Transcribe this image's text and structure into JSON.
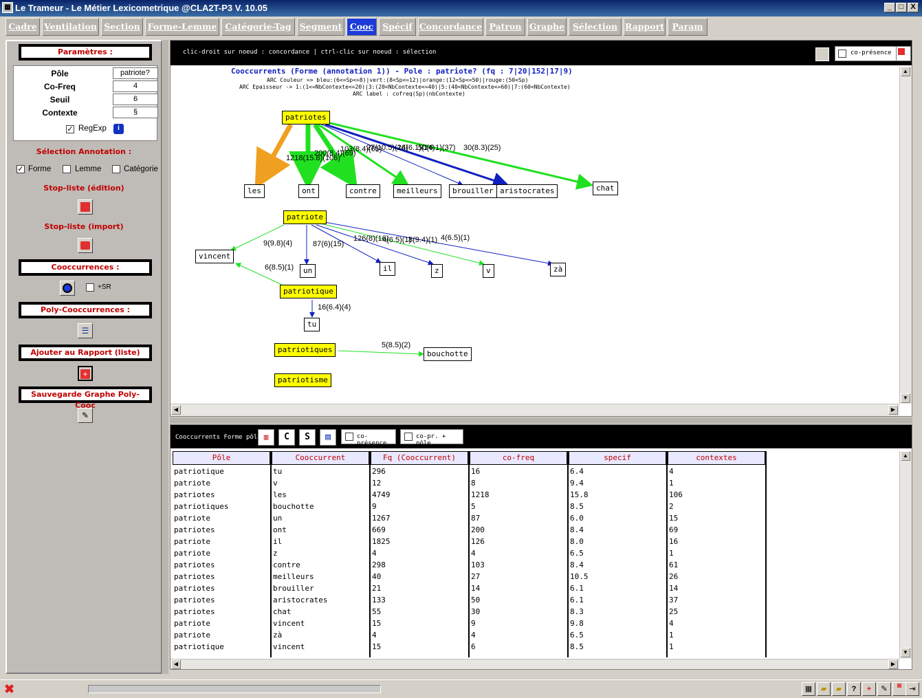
{
  "window": {
    "title": "Le Trameur - Le Métier Lexicometrique @CLA2T-P3 V. 10.05",
    "app_icon": "trameur-app-icon",
    "controls": [
      "_",
      "□",
      "X"
    ]
  },
  "tabs": [
    {
      "label": "Cadre",
      "active": false
    },
    {
      "label": "Ventilation",
      "active": false
    },
    {
      "label": "Section",
      "active": false
    },
    {
      "label": "Forme-Lemme",
      "active": false
    },
    {
      "label": "Catégorie-Tag",
      "active": false
    },
    {
      "label": "Segment",
      "active": false
    },
    {
      "label": "Cooc",
      "active": true
    },
    {
      "label": "Spécif",
      "active": false
    },
    {
      "label": "Concordance",
      "active": false
    },
    {
      "label": "Patron",
      "active": false
    },
    {
      "label": "Graphe",
      "active": false
    },
    {
      "label": "Sélection",
      "active": false
    },
    {
      "label": "Rapport",
      "active": false
    },
    {
      "label": "Param",
      "active": false
    }
  ],
  "left": {
    "params_title": "Paramètres :",
    "params": [
      {
        "label": "Pôle",
        "value": "patriote?"
      },
      {
        "label": "Co-Freq",
        "value": "4"
      },
      {
        "label": "Seuil",
        "value": "6"
      },
      {
        "label": "Contexte",
        "value": "§"
      }
    ],
    "regexp_label": "RegExp",
    "regexp_checked": true,
    "annotation_title": "Sélection Annotation :",
    "annotations": [
      {
        "label": "Forme",
        "checked": true
      },
      {
        "label": "Lemme",
        "checked": false
      },
      {
        "label": "Catégorie",
        "checked": false
      }
    ],
    "stoplist_edit": "Stop-liste (édition)",
    "stoplist_import": "Stop-liste (import)",
    "cooc_title": "Cooccurrences :",
    "plus_sr_label": "+SR",
    "poly_title": "Poly-Cooccurrences :",
    "add_report": "Ajouter au Rapport (liste)",
    "save_graph": "Sauvegarde Graphe Poly-Cooc"
  },
  "graph": {
    "hint": "clic-droit sur noeud : concordance | ctrl-clic sur noeud : sélection",
    "copresence_label": "co-présence",
    "title": "Cooccurrents (Forme (annotation 1)) - Pole : patriote? (fq : 7|20|152|17|9)",
    "legend_lines": [
      "ARC Couleur => bleu:(6<=Sp<=8)|vert:(8<Sp<=12)|orange:(12<Sp<=50)|rouge:(50<Sp)",
      "ARC Epaisseur -> 1:(1<=NbContexte<=20)|3:(20<NbContexte<=40)|5:(40<NbContexte<=60)|7:(60<NbContexte)",
      "ARC label : cofreq(Sp)(nbContexte)"
    ],
    "nodes": [
      {
        "id": "patriotes",
        "label": "patriotes",
        "pole": true
      },
      {
        "id": "les",
        "label": "les",
        "pole": false
      },
      {
        "id": "ont",
        "label": "ont",
        "pole": false
      },
      {
        "id": "contre",
        "label": "contre",
        "pole": false
      },
      {
        "id": "meilleurs",
        "label": "meilleurs",
        "pole": false
      },
      {
        "id": "brouiller",
        "label": "brouiller",
        "pole": false
      },
      {
        "id": "aristocrates",
        "label": "aristocrates",
        "pole": false
      },
      {
        "id": "chat",
        "label": "chat",
        "pole": false
      },
      {
        "id": "patriote",
        "label": "patriote",
        "pole": true
      },
      {
        "id": "vincent",
        "label": "vincent",
        "pole": false
      },
      {
        "id": "un",
        "label": "un",
        "pole": false
      },
      {
        "id": "il",
        "label": "il",
        "pole": false
      },
      {
        "id": "z",
        "label": "z",
        "pole": false
      },
      {
        "id": "v",
        "label": "v",
        "pole": false
      },
      {
        "id": "za",
        "label": "zà",
        "pole": false
      },
      {
        "id": "patriotique",
        "label": "patriotique",
        "pole": true
      },
      {
        "id": "tu",
        "label": "tu",
        "pole": false
      },
      {
        "id": "patriotiques",
        "label": "patriotiques",
        "pole": true
      },
      {
        "id": "bouchotte",
        "label": "bouchotte",
        "pole": false
      },
      {
        "id": "patriotisme",
        "label": "patriotisme",
        "pole": true
      }
    ],
    "edges": [
      {
        "from": "patriotes",
        "to": "les",
        "label": "1218(15.8)(106)",
        "color": "#f0a020"
      },
      {
        "from": "patriotes",
        "to": "ont",
        "label": "200(8.4)(69)",
        "color": "#20e020"
      },
      {
        "from": "patriotes",
        "to": "contre",
        "label": "103(8.4)(61)",
        "color": "#20e020"
      },
      {
        "from": "patriotes",
        "to": "meilleurs",
        "label": "27(10.5)(26)",
        "color": "#20e020"
      },
      {
        "from": "patriotes",
        "to": "brouiller",
        "label": "14(6.1)(14)",
        "color": "#1020c0"
      },
      {
        "from": "patriotes",
        "to": "aristocrates",
        "label": "50(6.1)(37)",
        "color": "#1020c0"
      },
      {
        "from": "patriotes",
        "to": "chat",
        "label": "30(8.3)(25)",
        "color": "#20e020"
      },
      {
        "from": "patriote",
        "to": "vincent",
        "label": "9(9.8)(4)",
        "color": "#20e020"
      },
      {
        "from": "patriote",
        "to": "un",
        "label": "87(6)(15)",
        "color": "#1020c0"
      },
      {
        "from": "patriote",
        "to": "il",
        "label": "126(8)(16)",
        "color": "#1020c0"
      },
      {
        "from": "patriote",
        "to": "z",
        "label": "4(6.5)(1)",
        "color": "#1020c0"
      },
      {
        "from": "patriote",
        "to": "v",
        "label": "8(9.4)(1)",
        "color": "#20e020"
      },
      {
        "from": "patriote",
        "to": "za",
        "label": "4(6.5)(1)",
        "color": "#1020c0"
      },
      {
        "from": "patriotique",
        "to": "vincent",
        "label": "6(8.5)(1)",
        "color": "#20e020"
      },
      {
        "from": "patriotique",
        "to": "tu",
        "label": "16(6.4)(4)",
        "color": "#1020c0"
      },
      {
        "from": "patriotiques",
        "to": "bouchotte",
        "label": "5(8.5)(2)",
        "color": "#20e020"
      }
    ]
  },
  "table": {
    "toolbar_label": "Cooccurrents Forme pôle",
    "copresence_label": "co-présence",
    "copr_pole_label": "co-pr. + pôle",
    "columns": [
      "Pôle",
      "Cooccurrent",
      "Fq (Cooccurrent)",
      "co-freq",
      "specif",
      "contextes"
    ],
    "rows": [
      [
        "patriotique",
        "tu",
        "296",
        "16",
        "6.4",
        "4"
      ],
      [
        "patriote",
        "v",
        "12",
        "8",
        "9.4",
        "1"
      ],
      [
        "patriotes",
        "les",
        "4749",
        "1218",
        "15.8",
        "106"
      ],
      [
        "patriotiques",
        "bouchotte",
        "9",
        "5",
        "8.5",
        "2"
      ],
      [
        "patriote",
        "un",
        "1267",
        "87",
        "6.0",
        "15"
      ],
      [
        "patriotes",
        "ont",
        "669",
        "200",
        "8.4",
        "69"
      ],
      [
        "patriote",
        "il",
        "1825",
        "126",
        "8.0",
        "16"
      ],
      [
        "patriote",
        "z",
        "4",
        "4",
        "6.5",
        "1"
      ],
      [
        "patriotes",
        "contre",
        "298",
        "103",
        "8.4",
        "61"
      ],
      [
        "patriotes",
        "meilleurs",
        "40",
        "27",
        "10.5",
        "26"
      ],
      [
        "patriotes",
        "brouiller",
        "21",
        "14",
        "6.1",
        "14"
      ],
      [
        "patriotes",
        "aristocrates",
        "133",
        "50",
        "6.1",
        "37"
      ],
      [
        "patriotes",
        "chat",
        "55",
        "30",
        "8.3",
        "25"
      ],
      [
        "patriote",
        "vincent",
        "15",
        "9",
        "9.8",
        "4"
      ],
      [
        "patriote",
        "zà",
        "4",
        "4",
        "6.5",
        "1"
      ],
      [
        "patriotique",
        "vincent",
        "15",
        "6",
        "8.5",
        "1"
      ]
    ]
  },
  "status": {
    "close_icon": "red-x-icon"
  },
  "colors": {
    "tab_active": "#1c3bd8",
    "red_label": "#c00000",
    "pole_node": "#ffff00"
  }
}
